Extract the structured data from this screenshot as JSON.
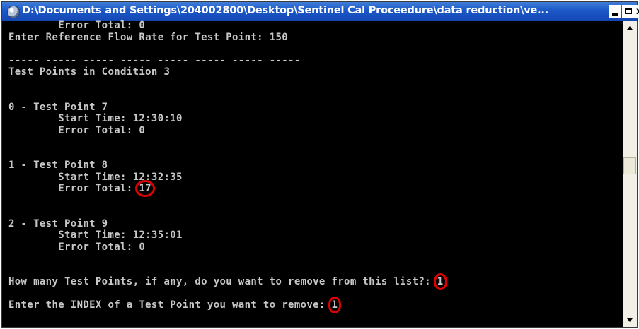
{
  "window": {
    "title": "D:\\Documents and Settings\\204002800\\Desktop\\Sentinel Cal Proceedure\\data reduction\\ve...",
    "minimize_label": "_",
    "maximize_label": "□",
    "close_label": "x"
  },
  "console": {
    "line_01": "        Error Total: 0",
    "line_02": "Enter Reference Flow Rate for Test Point: 150",
    "line_03": "",
    "line_04": "----- ----- ----- ----- ----- ----- ----- -----",
    "line_05": "Test Points in Condition 3",
    "line_06": "",
    "line_07": "",
    "line_08": "0 - Test Point 7",
    "line_09": "        Start Time: 12:30:10",
    "line_10": "        Error Total: 0",
    "line_11": "",
    "line_12": "",
    "line_13": "1 - Test Point 8",
    "line_14": "        Start Time: 12:32:35",
    "line_15_prefix": "        Error Total: ",
    "line_15_value": "17",
    "line_16": "",
    "line_17": "",
    "line_18": "2 - Test Point 9",
    "line_19": "        Start Time: 12:35:01",
    "line_20": "        Error Total: 0",
    "line_21": "",
    "line_22": "",
    "line_23_prefix": "How many Test Points, if any, do you want to remove from this list?: ",
    "line_23_value": "1",
    "line_24": "",
    "line_25_prefix": "Enter the INDEX of a Test Point you want to remove: ",
    "line_25_value": "1"
  },
  "colors": {
    "console_bg": "#000000",
    "console_text": "#c8c8c8",
    "titlebar": "#1b57c7",
    "annotation_circle": "#e00000"
  },
  "icons": {
    "system_menu": "console-app-icon",
    "scroll_up": "arrow-up-icon",
    "scroll_down": "arrow-down-icon"
  }
}
